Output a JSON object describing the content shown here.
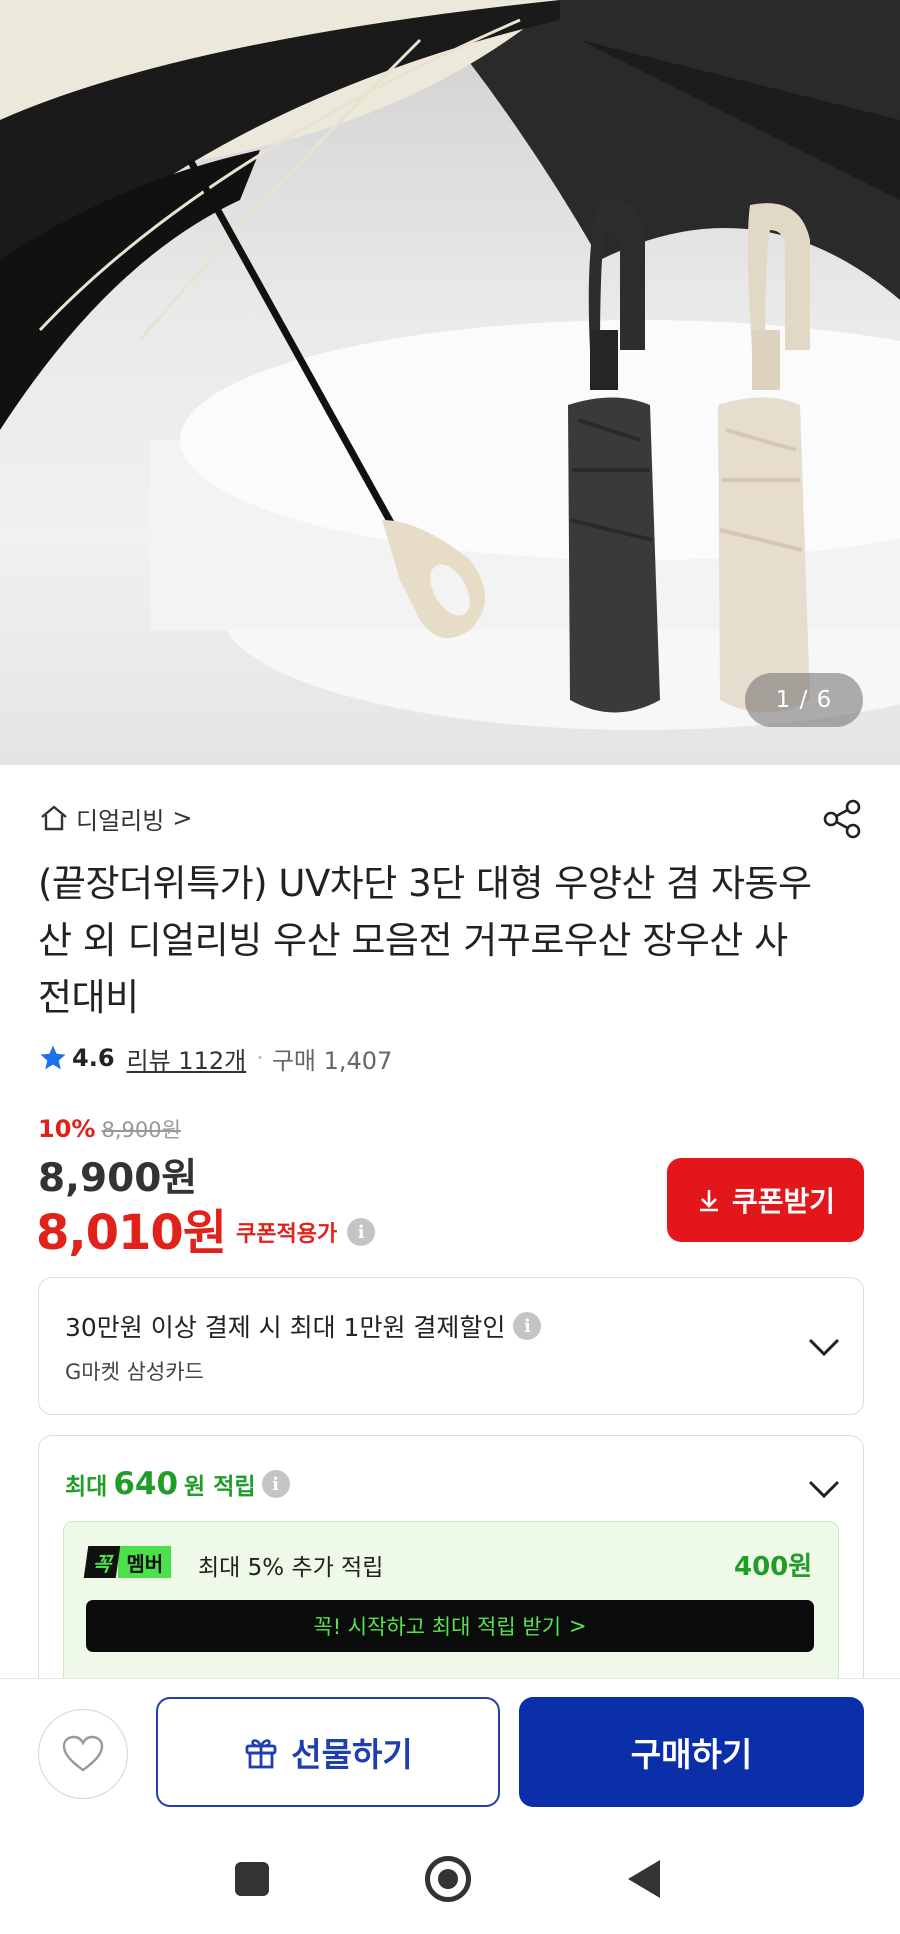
{
  "gallery": {
    "counter": "1 / 6"
  },
  "store": {
    "name": "디얼리빙",
    "chevron": ">"
  },
  "product": {
    "title": "(끝장더위특가) UV차단 3단 대형 우양산 겸 자동우산 외 디얼리빙 우산 모음전 거꾸로우산 장우산 사전대비",
    "rating": "4.6",
    "review_label": "리뷰 112개",
    "separator": "·",
    "purchase_label": "구매 1,407"
  },
  "price": {
    "discount_pct": "10%",
    "original_price": "8,900원",
    "price": "8,900원",
    "coupon_price": "8,010원",
    "coupon_apply_label": "쿠폰적용가",
    "coupon_button_label": "쿠폰받기"
  },
  "card_benefit": {
    "title": "30만원 이상 결제 시 최대 1만원 결제할인",
    "subtitle": "G마켓 삼성카드"
  },
  "points": {
    "prefix": "최대",
    "amount": "640",
    "suffix": "원 적립",
    "member_badge_1": "꼭",
    "member_badge_2": "멤버",
    "member_text": "최대 5% 추가 적립",
    "member_amount": "400원",
    "member_cta": "꼭! 시작하고 최대 적립 받기",
    "member_cta_chevron": ">"
  },
  "actions": {
    "gift_label": "선물하기",
    "buy_label": "구매하기"
  },
  "colors": {
    "accent_red": "#e3161b",
    "buy_blue": "#0a2fa9",
    "points_green": "#1e9d27"
  },
  "icons": [
    "home-icon",
    "share-icon",
    "star-icon",
    "info-icon",
    "download-icon",
    "chevron-down-icon",
    "heart-icon",
    "gift-icon",
    "recent-apps-icon",
    "home-nav-icon",
    "back-icon"
  ]
}
